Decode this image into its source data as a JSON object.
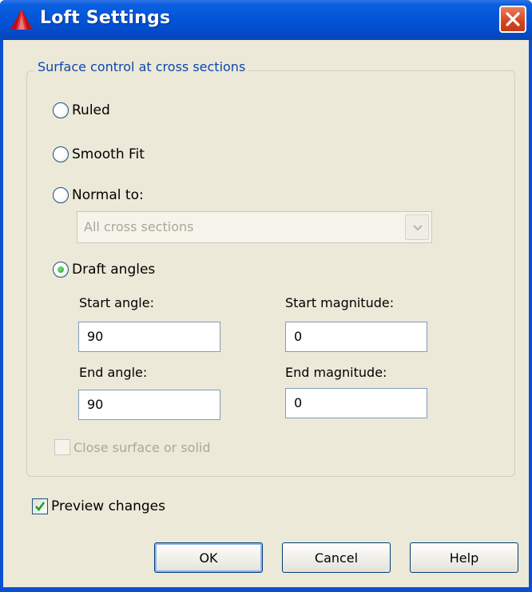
{
  "window": {
    "title": "Loft Settings",
    "accent": "#0253d6",
    "close_color": "#d4431c"
  },
  "group": {
    "legend": "Surface control at cross sections",
    "options": [
      {
        "label": "Ruled",
        "selected": false
      },
      {
        "label": "Smooth Fit",
        "selected": false
      },
      {
        "label": "Normal to:",
        "selected": false
      },
      {
        "label": "Draft angles",
        "selected": true
      }
    ],
    "normal_to_select": {
      "value": "All cross sections",
      "enabled": false
    },
    "fields": {
      "start_angle": {
        "label": "Start angle:",
        "value": "90"
      },
      "start_magnitude": {
        "label": "Start magnitude:",
        "value": "0"
      },
      "end_angle": {
        "label": "End angle:",
        "value": "90"
      },
      "end_magnitude": {
        "label": "End magnitude:",
        "value": "0"
      }
    },
    "close_surface": {
      "label": "Close surface or solid",
      "checked": false,
      "enabled": false
    }
  },
  "preview": {
    "label": "Preview changes",
    "checked": true
  },
  "buttons": {
    "ok": "OK",
    "cancel": "Cancel",
    "help": "Help"
  },
  "icons": {
    "app": "autocad-app-icon",
    "close": "close-icon",
    "dropdown": "chevron-down-icon",
    "check": "checkmark-icon"
  }
}
